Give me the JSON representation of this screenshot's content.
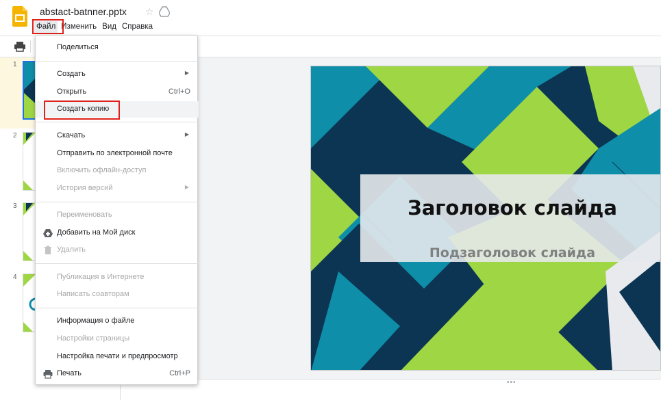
{
  "window": {
    "doc_title": "abstact-batnner.pptx"
  },
  "menubar": {
    "file": "Файл",
    "edit": "Изменить",
    "view": "Вид",
    "help": "Справка"
  },
  "file_menu": {
    "share": "Поделиться",
    "new": "Создать",
    "open": "Открыть",
    "open_shortcut": "Ctrl+O",
    "make_copy": "Создать копию",
    "download": "Скачать",
    "email": "Отправить по электронной почте",
    "offline": "Включить офлайн-доступ",
    "version_history": "История версий",
    "rename": "Переименовать",
    "add_to_drive": "Добавить на Мой диск",
    "delete": "Удалить",
    "publish": "Публикация в Интернете",
    "email_collaborators": "Написать соавторам",
    "file_info": "Информация о файле",
    "page_setup": "Настройки страницы",
    "print_settings": "Настройка печати и предпросмотр",
    "print": "Печать",
    "print_shortcut": "Ctrl+P"
  },
  "filmstrip": {
    "slide_numbers": [
      "1",
      "2",
      "3",
      "4"
    ]
  },
  "slide": {
    "title": "Заголовок слайда",
    "subtitle": "Подзаголовок слайда"
  },
  "colors": {
    "highlight_red": "#e0201a",
    "accent_blue": "#1a73e8",
    "lime": "#9fd644",
    "teal": "#0e8ea8",
    "navy": "#0c3553",
    "slides_yellow": "#f4b400"
  }
}
